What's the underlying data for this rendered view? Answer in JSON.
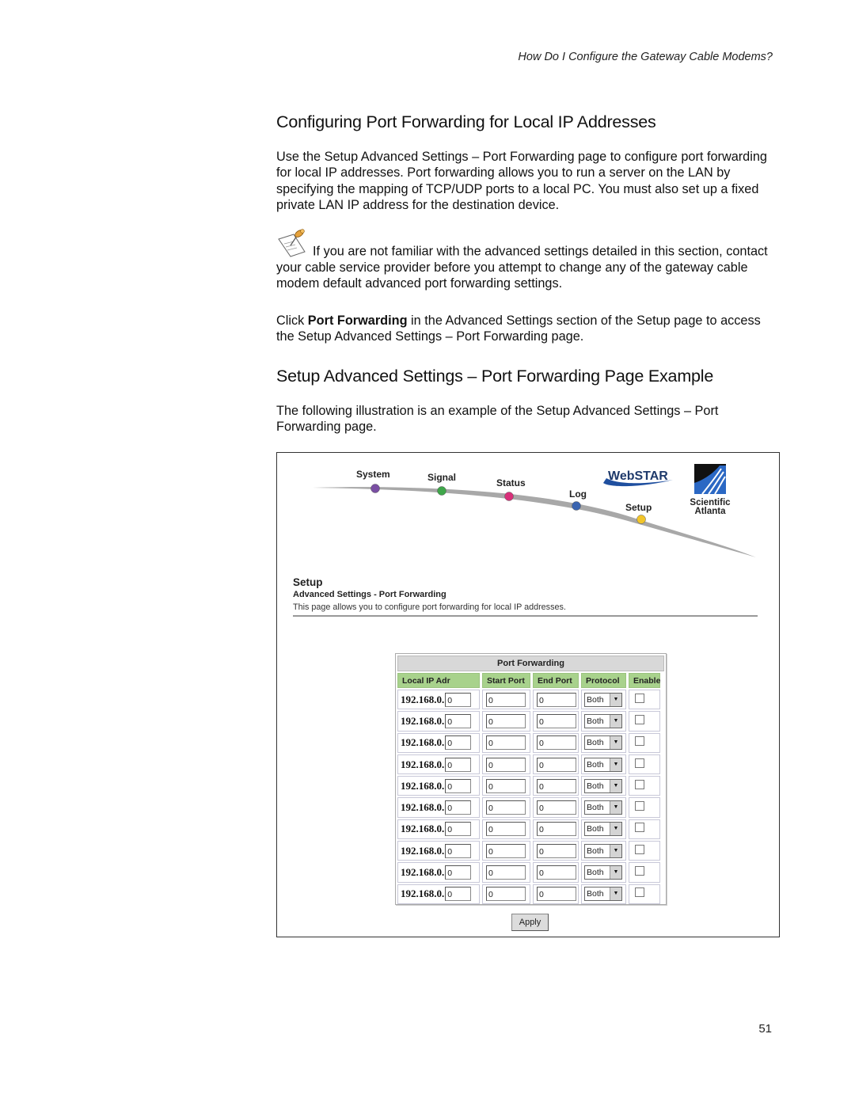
{
  "running_head": "How Do I Configure the Gateway Cable Modems?",
  "section1": {
    "heading": "Configuring Port Forwarding for Local IP Addresses",
    "paragraph": "Use the Setup Advanced Settings – Port Forwarding page to configure port forwarding for local IP addresses. Port forwarding allows you to run a server on the LAN by specifying the mapping of TCP/UDP ports to a local PC. You must also set up a fixed private LAN IP address for the destination device.",
    "note_icon": "note-pin-icon",
    "note": "If you are not familiar with the advanced settings detailed in this section, contact your cable service provider before you attempt to change any of the gateway cable modem default advanced port forwarding settings.",
    "click_prefix": "Click ",
    "click_bold": "Port Forwarding",
    "click_suffix": " in the Advanced Settings section of the Setup page to access the Setup Advanced Settings – Port Forwarding page."
  },
  "section2": {
    "heading": "Setup Advanced Settings – Port Forwarding Page Example",
    "paragraph": "The following illustration is an example of the Setup Advanced Settings – Port Forwarding page."
  },
  "figure": {
    "nav": [
      {
        "label": "System",
        "color": "#7a4fa3"
      },
      {
        "label": "Signal",
        "color": "#3fa64a"
      },
      {
        "label": "Status",
        "color": "#d8307a"
      },
      {
        "label": "Log",
        "color": "#3a64b0"
      },
      {
        "label": "Setup",
        "color": "#f2c52a"
      }
    ],
    "brand": "WebSTAR",
    "brand_color": "#1f4f9f",
    "company_line1": "Scientific",
    "company_line2": "Atlanta",
    "page_title": "Setup",
    "page_subtitle": "Advanced Settings - Port Forwarding",
    "page_desc": "This page allows you to configure port forwarding for local IP addresses.",
    "table": {
      "caption": "Port Forwarding",
      "columns": [
        "Local IP Adr",
        "Start Port",
        "End Port",
        "Protocol",
        "Enable"
      ],
      "header_color": "#a8d28c",
      "rows": [
        {
          "ip_prefix": "192.168.0.",
          "ip_last": "0",
          "start": "0",
          "end": "0",
          "protocol": "Both",
          "enabled": false
        },
        {
          "ip_prefix": "192.168.0.",
          "ip_last": "0",
          "start": "0",
          "end": "0",
          "protocol": "Both",
          "enabled": false
        },
        {
          "ip_prefix": "192.168.0.",
          "ip_last": "0",
          "start": "0",
          "end": "0",
          "protocol": "Both",
          "enabled": false
        },
        {
          "ip_prefix": "192.168.0.",
          "ip_last": "0",
          "start": "0",
          "end": "0",
          "protocol": "Both",
          "enabled": false
        },
        {
          "ip_prefix": "192.168.0.",
          "ip_last": "0",
          "start": "0",
          "end": "0",
          "protocol": "Both",
          "enabled": false
        },
        {
          "ip_prefix": "192.168.0.",
          "ip_last": "0",
          "start": "0",
          "end": "0",
          "protocol": "Both",
          "enabled": false
        },
        {
          "ip_prefix": "192.168.0.",
          "ip_last": "0",
          "start": "0",
          "end": "0",
          "protocol": "Both",
          "enabled": false
        },
        {
          "ip_prefix": "192.168.0.",
          "ip_last": "0",
          "start": "0",
          "end": "0",
          "protocol": "Both",
          "enabled": false
        },
        {
          "ip_prefix": "192.168.0.",
          "ip_last": "0",
          "start": "0",
          "end": "0",
          "protocol": "Both",
          "enabled": false
        },
        {
          "ip_prefix": "192.168.0.",
          "ip_last": "0",
          "start": "0",
          "end": "0",
          "protocol": "Both",
          "enabled": false
        }
      ]
    },
    "apply_label": "Apply"
  },
  "page_number": "51"
}
